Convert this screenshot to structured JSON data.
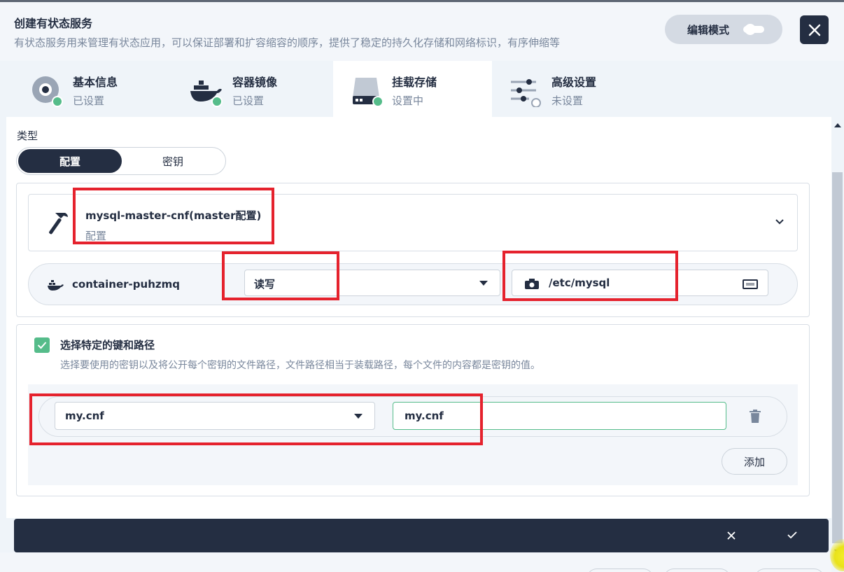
{
  "header": {
    "title": "创建有状态服务",
    "description": "有状态服务用来管理有状态应用，可以保证部署和扩容缩容的顺序，提供了稳定的持久化存储和网络标识，有序伸缩等",
    "edit_mode_label": "编辑模式"
  },
  "tabs": [
    {
      "name": "基本信息",
      "status": "已设置",
      "icon": "disk-icon"
    },
    {
      "name": "容器镜像",
      "status": "已设置",
      "icon": "docker-icon"
    },
    {
      "name": "挂载存储",
      "status": "设置中",
      "icon": "storage-icon"
    },
    {
      "name": "高级设置",
      "status": "未设置",
      "icon": "sliders-icon"
    }
  ],
  "form": {
    "type_label": "类型",
    "type_options": [
      "配置",
      "密钥"
    ],
    "selected_type": "配置",
    "config": {
      "name": "mysql-master-cnf(master配置)",
      "kind": "配置"
    },
    "container_name": "container-puhzmq",
    "access_mode": "读写",
    "mount_path": "/etc/mysql",
    "specific_keys": {
      "checked": true,
      "title": "选择特定的键和路径",
      "description": "选择要使用的密钥以及将公开每个密钥的文件路径，文件路径相当于装载路径，每个文件的内容都是密钥的值。",
      "key": "my.cnf",
      "path": "my.cnf",
      "add_label": "添加"
    }
  },
  "colors": {
    "dark": "#242e42",
    "accent_green": "#55bc8a",
    "highlight_red": "#e5222d"
  }
}
